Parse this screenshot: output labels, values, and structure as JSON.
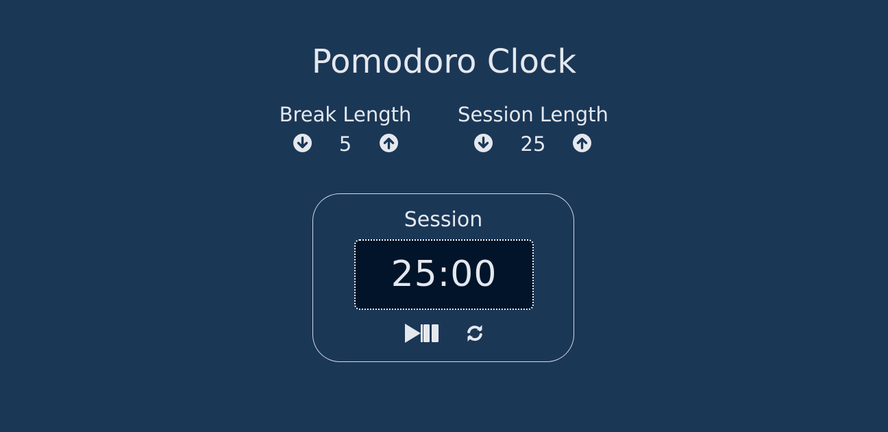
{
  "app": {
    "title": "Pomodoro Clock"
  },
  "break_control": {
    "label": "Break Length",
    "value": "5",
    "decrement_icon": "arrow-circle-down-icon",
    "increment_icon": "arrow-circle-up-icon"
  },
  "session_control": {
    "label": "Session Length",
    "value": "25",
    "decrement_icon": "arrow-circle-down-icon",
    "increment_icon": "arrow-circle-up-icon"
  },
  "timer": {
    "label": "Session",
    "time": "25:00",
    "play_pause_icon": "play-pause-icon",
    "reset_icon": "refresh-icon"
  },
  "colors": {
    "background": "#1b3756",
    "text": "#e4e8ee",
    "display_background": "#01142a",
    "border": "#d3d9e2"
  }
}
